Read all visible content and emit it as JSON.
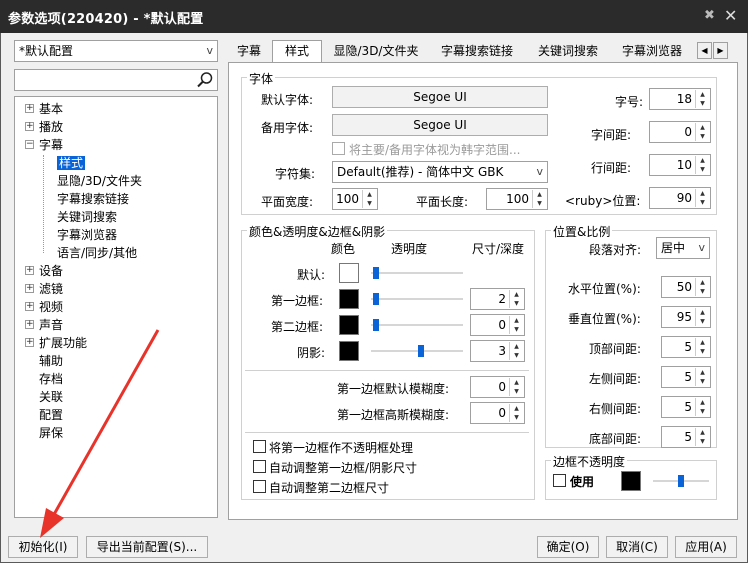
{
  "window": {
    "title": "参数选项(220420) - *默认配置",
    "pin": "✖",
    "close": "✕"
  },
  "profile": {
    "value": "*默认配置",
    "arrow": "v"
  },
  "tree": {
    "items": [
      {
        "label": "基本",
        "expander": "+",
        "level": 0
      },
      {
        "label": "播放",
        "expander": "+",
        "level": 0
      },
      {
        "label": "字幕",
        "expander": "−",
        "level": 0
      },
      {
        "label": "样式",
        "expander": "",
        "level": 1,
        "selected": true
      },
      {
        "label": "显隐/3D/文件夹",
        "expander": "",
        "level": 1
      },
      {
        "label": "字幕搜索链接",
        "expander": "",
        "level": 1
      },
      {
        "label": "关键词搜索",
        "expander": "",
        "level": 1
      },
      {
        "label": "字幕浏览器",
        "expander": "",
        "level": 1
      },
      {
        "label": "语言/同步/其他",
        "expander": "",
        "level": 1
      },
      {
        "label": "设备",
        "expander": "+",
        "level": 0
      },
      {
        "label": "滤镜",
        "expander": "+",
        "level": 0
      },
      {
        "label": "视频",
        "expander": "+",
        "level": 0
      },
      {
        "label": "声音",
        "expander": "+",
        "level": 0
      },
      {
        "label": "扩展功能",
        "expander": "+",
        "level": 0
      },
      {
        "label": "辅助",
        "expander": "",
        "level": 0
      },
      {
        "label": "存档",
        "expander": "",
        "level": 0
      },
      {
        "label": "关联",
        "expander": "",
        "level": 0
      },
      {
        "label": "配置",
        "expander": "",
        "level": 0
      },
      {
        "label": "屏保",
        "expander": "",
        "level": 0
      }
    ]
  },
  "tabs": [
    {
      "label": "字幕"
    },
    {
      "label": "样式",
      "active": true
    },
    {
      "label": "显隐/3D/文件夹"
    },
    {
      "label": "字幕搜索链接"
    },
    {
      "label": "关键词搜索"
    },
    {
      "label": "字幕浏览器"
    }
  ],
  "tabnav": {
    "left": "◀",
    "right": "▶"
  },
  "font": {
    "group_title": "字体",
    "default_label": "默认字体:",
    "default_value": "Segoe UI",
    "backup_label": "备用字体:",
    "backup_value": "Segoe UI",
    "korean_label": "将主要/备用字体视为韩字范围...",
    "charset_label": "字符集:",
    "charset_value": "Default(推荐) - 简体中文 GBK",
    "charset_arrow": "v",
    "width_label": "平面宽度:",
    "width_value": "100",
    "length_label": "平面长度:",
    "length_value": "100",
    "size_label": "字号:",
    "size_value": "18",
    "spacing_label": "字间距:",
    "spacing_value": "0",
    "line_label": "行间距:",
    "line_value": "10",
    "ruby_label": "<ruby>位置:",
    "ruby_value": "90"
  },
  "color": {
    "group_title": "颜色&透明度&边框&阴影",
    "col_color": "颜色",
    "col_opacity": "透明度",
    "col_size": "尺寸/深度",
    "rows": [
      {
        "label": "默认:",
        "swatch": "#ffffff",
        "opacity": 0.02,
        "size": ""
      },
      {
        "label": "第一边框:",
        "swatch": "#000000",
        "opacity": 0.02,
        "size": "2"
      },
      {
        "label": "第二边框:",
        "swatch": "#000000",
        "opacity": 0.02,
        "size": "0"
      },
      {
        "label": "阴影:",
        "swatch": "#000000",
        "opacity": 0.55,
        "size": "3"
      }
    ],
    "blur1_label": "第一边框默认模糊度:",
    "blur1_value": "0",
    "blur2_label": "第一边框高斯模糊度:",
    "blur2_value": "0",
    "opt1": "将第一边框作不透明框处理",
    "opt2": "自动调整第一边框/阴影尺寸",
    "opt3": "自动调整第二边框尺寸"
  },
  "position": {
    "group_title": "位置&比例",
    "align_label": "段落对齐:",
    "align_value": "居中",
    "align_arrow": "v",
    "hpos_label": "水平位置(%):",
    "hpos_value": "50",
    "vpos_label": "垂直位置(%):",
    "vpos_value": "95",
    "top_label": "顶部间距:",
    "top_value": "5",
    "left_label": "左侧间距:",
    "left_value": "5",
    "right_label": "右侧间距:",
    "right_value": "5",
    "bottom_label": "底部间距:",
    "bottom_value": "5"
  },
  "border_opacity": {
    "group_title": "边框不透明度",
    "use_label": "使用",
    "swatch": "#000000",
    "slider": 0.5
  },
  "buttons": {
    "init": "初始化(I)",
    "export": "导出当前配置(S)...",
    "ok": "确定(O)",
    "cancel": "取消(C)",
    "apply": "应用(A)"
  },
  "colors": {
    "accent": "#0a64d8",
    "annotation": "#e8332a",
    "titlebar": "#2b2b2b"
  }
}
